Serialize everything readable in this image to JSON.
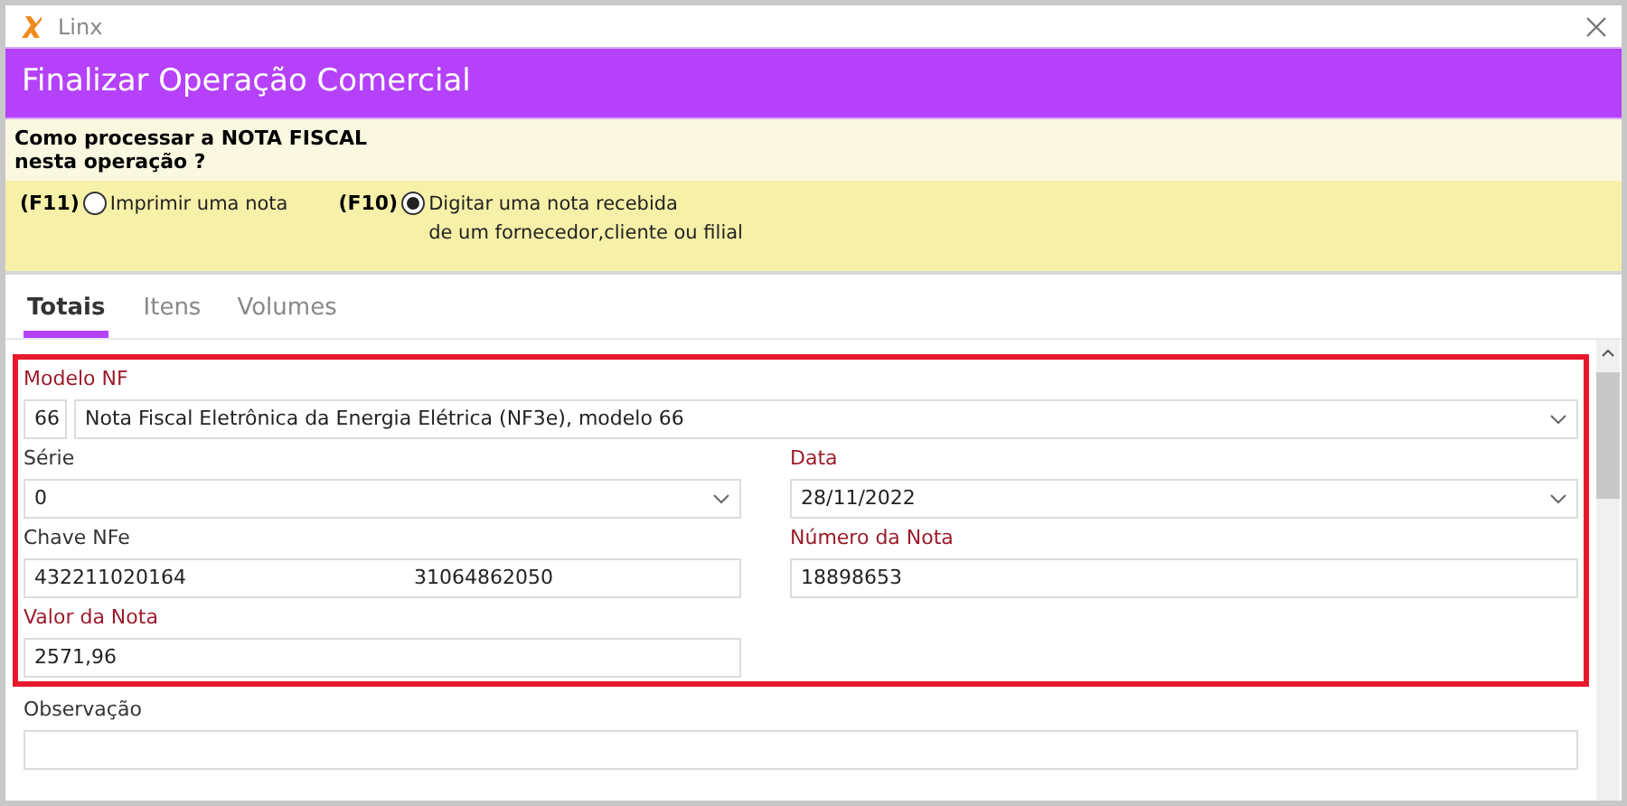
{
  "window": {
    "title": "Linx"
  },
  "header": {
    "title": "Finalizar Operação Comercial"
  },
  "question": {
    "text": "Como processar a NOTA FISCAL\nnesta operação ?"
  },
  "options": [
    {
      "key": "(F11)",
      "label": "Imprimir uma nota",
      "selected": false
    },
    {
      "key": "(F10)",
      "label": "Digitar uma nota recebida\nde um fornecedor,cliente ou filial",
      "selected": true
    }
  ],
  "tabs": [
    {
      "label": "Totais",
      "selected": true
    },
    {
      "label": "Itens",
      "selected": false
    },
    {
      "label": "Volumes",
      "selected": false
    }
  ],
  "modelo": {
    "label": "Modelo NF",
    "required": true,
    "code": "66",
    "value": "Nota Fiscal Eletrônica da Energia Elétrica (NF3e), modelo 66"
  },
  "fields": [
    {
      "label": "Série",
      "required": false,
      "kind": "combo",
      "value": "0"
    },
    {
      "label": "Data",
      "required": true,
      "kind": "combo",
      "value": "28/11/2022"
    },
    {
      "label": "Chave NFe",
      "required": false,
      "kind": "split",
      "value": "432211020164",
      "value_2": "31064862050"
    },
    {
      "label": "Número da Nota",
      "required": true,
      "kind": "text",
      "value": "18898653"
    },
    {
      "label": "Valor da Nota",
      "required": true,
      "kind": "text",
      "value": "2571,96"
    }
  ],
  "observacao": {
    "label": "Observação",
    "required": false
  }
}
